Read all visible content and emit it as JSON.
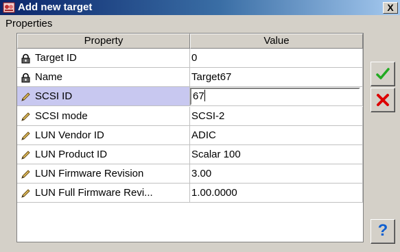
{
  "window": {
    "title": "Add new target",
    "close_label": "X"
  },
  "section_label": "Properties",
  "table": {
    "columns": [
      "Property",
      "Value"
    ],
    "rows": [
      {
        "icon": "lock-icon",
        "property": "Target ID",
        "value": "0"
      },
      {
        "icon": "lock-icon",
        "property": "Name",
        "value": "Target67"
      },
      {
        "icon": "pencil-icon",
        "property": "SCSI ID",
        "value": "67",
        "editing": true
      },
      {
        "icon": "pencil-icon",
        "property": "SCSI mode",
        "value": "SCSI-2"
      },
      {
        "icon": "pencil-icon",
        "property": "LUN Vendor ID",
        "value": "ADIC"
      },
      {
        "icon": "pencil-icon",
        "property": "LUN Product ID",
        "value": "Scalar 100"
      },
      {
        "icon": "pencil-icon",
        "property": "LUN Firmware Revision",
        "value": "3.00"
      },
      {
        "icon": "pencil-icon",
        "property": "LUN Full Firmware Revi...",
        "value": "1.00.0000"
      }
    ]
  },
  "buttons": {
    "ok_icon": "checkmark-icon",
    "cancel_icon": "red-x-icon",
    "help_label": "?"
  },
  "colors": {
    "titlebar": "#0a246a",
    "selected_row": "#c8c8f0",
    "ok_green": "#22aa22",
    "cancel_red": "#dd0000",
    "help_blue": "#1060d0"
  }
}
